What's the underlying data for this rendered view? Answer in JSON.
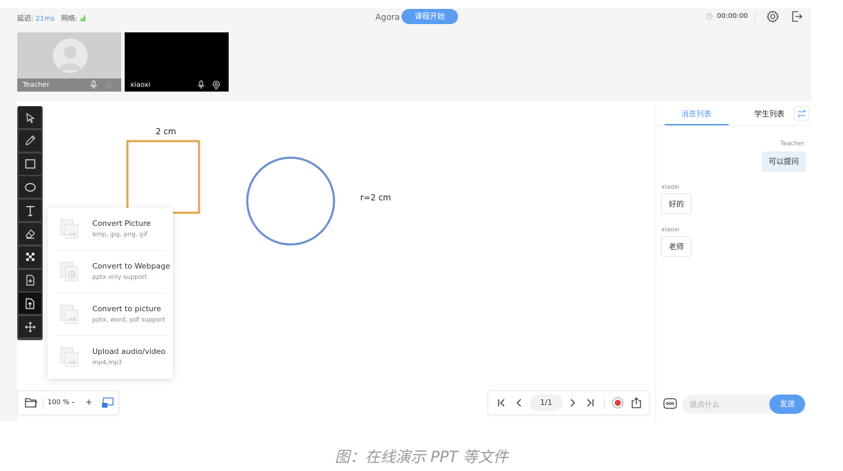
{
  "topbar": {
    "latency_label": "延迟:",
    "latency_value": "21ms",
    "network_label": "网络:",
    "room_name": "Agora",
    "start_button": "课程开始",
    "timer": "00:00:00"
  },
  "videos": {
    "teacher_name": "Teacher",
    "student_name": "xiaoxi"
  },
  "board": {
    "square_label": "2 cm",
    "circle_label": "r=2 cm",
    "shape_colors": {
      "square": "#e0a54b",
      "circle": "#6b8fcf"
    }
  },
  "tools": [
    "selector-icon",
    "pencil-icon",
    "rectangle-icon",
    "ellipse-icon",
    "text-icon",
    "eraser-icon",
    "color-icon",
    "add-page-icon",
    "upload-icon",
    "hand-icon"
  ],
  "upload_menu": [
    {
      "title": "Convert Picture",
      "sub": "bmp, jpg, png, gif"
    },
    {
      "title": "Convert to Webpage",
      "sub": "pptx only support"
    },
    {
      "title": "Convert to picture",
      "sub": "pptx, word, pdf support"
    },
    {
      "title": "Upload audio/video",
      "sub": "mp4,mp3"
    }
  ],
  "zoom": {
    "value": "100 %",
    "minus": "-",
    "plus": "+"
  },
  "pager": {
    "page": "1/1"
  },
  "chat": {
    "tab_messages": "消息列表",
    "tab_students": "学生列表",
    "messages": [
      {
        "name": "Teacher",
        "text": "可以提问"
      },
      {
        "name": "xiaoxi",
        "text": "好的"
      },
      {
        "name": "xiaoxi",
        "text": "老师"
      }
    ],
    "input_placeholder": "说点什么",
    "send_label": "发送"
  },
  "caption": "图：在线演示 PPT 等文件",
  "colors": {
    "accent": "#5b9df2",
    "record": "#e03b3b"
  }
}
